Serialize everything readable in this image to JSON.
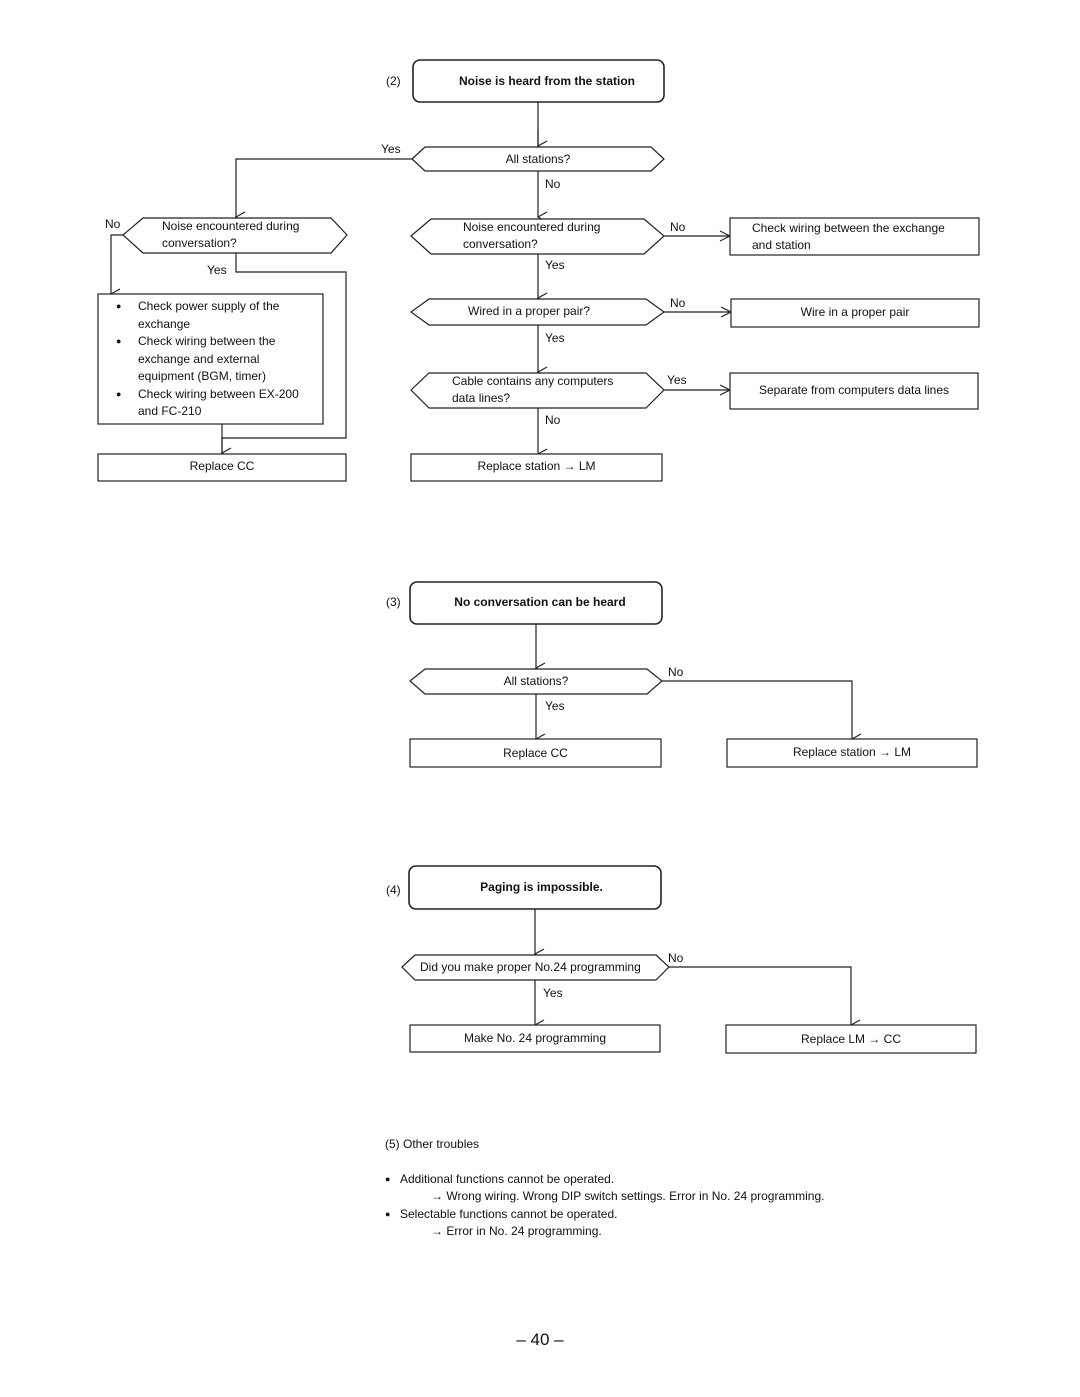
{
  "flow2": {
    "number": "(2)",
    "title": "Noise is heard from the station",
    "all_stations": "All stations?",
    "yes_all": "Yes",
    "no_all": "No",
    "left": {
      "decision": "Noise encountered during conversation?",
      "decision_line1": "Noise encountered during",
      "decision_line2": "conversation?",
      "no_label": "No",
      "yes_label": "Yes",
      "checks": [
        {
          "line1": "Check power supply of the",
          "line2": "exchange"
        },
        {
          "line1": "Check wiring between the",
          "line2": "exchange and external",
          "line3": "equipment (BGM, timer)"
        },
        {
          "line1": "Check wiring between EX-200",
          "line2": "and FC-210"
        }
      ],
      "replace": "Replace CC"
    },
    "right": {
      "decision1_line1": "Noise encountered during",
      "decision1_line2": "conversation?",
      "decision1_no": "No",
      "decision1_yes": "Yes",
      "action1_line1": "Check wiring between the exchange",
      "action1_line2": "and station",
      "decision2": "Wired in a proper pair?",
      "decision2_no": "No",
      "decision2_yes": "Yes",
      "action2": "Wire in a proper pair",
      "decision3_line1": "Cable contains any computers",
      "decision3_line2": "data lines?",
      "decision3_yes": "Yes",
      "decision3_no": "No",
      "action3": "Separate from computers data lines",
      "replace": "Replace station → LM"
    }
  },
  "flow3": {
    "number": "(3)",
    "title": "No conversation can be heard",
    "decision": "All stations?",
    "no_label": "No",
    "yes_label": "Yes",
    "yes_action": "Replace CC",
    "no_action": "Replace station → LM"
  },
  "flow4": {
    "number": "(4)",
    "title": "Paging is impossible.",
    "decision": "Did you make proper No.24 programming",
    "no_label": "No",
    "yes_label": "Yes",
    "yes_action": "Make No. 24 programming",
    "no_action": "Replace LM → CC"
  },
  "other": {
    "heading": "(5) Other troubles",
    "bullet_glyph": "●",
    "items": [
      {
        "problem": "Additional functions cannot be operated.",
        "cause": "→ Wrong wiring. Wrong DIP switch settings. Error in No. 24 programming."
      },
      {
        "problem": "Selectable functions cannot be operated.",
        "cause": "→ Error in No. 24 programming."
      }
    ]
  },
  "page_number": "– 40 –"
}
